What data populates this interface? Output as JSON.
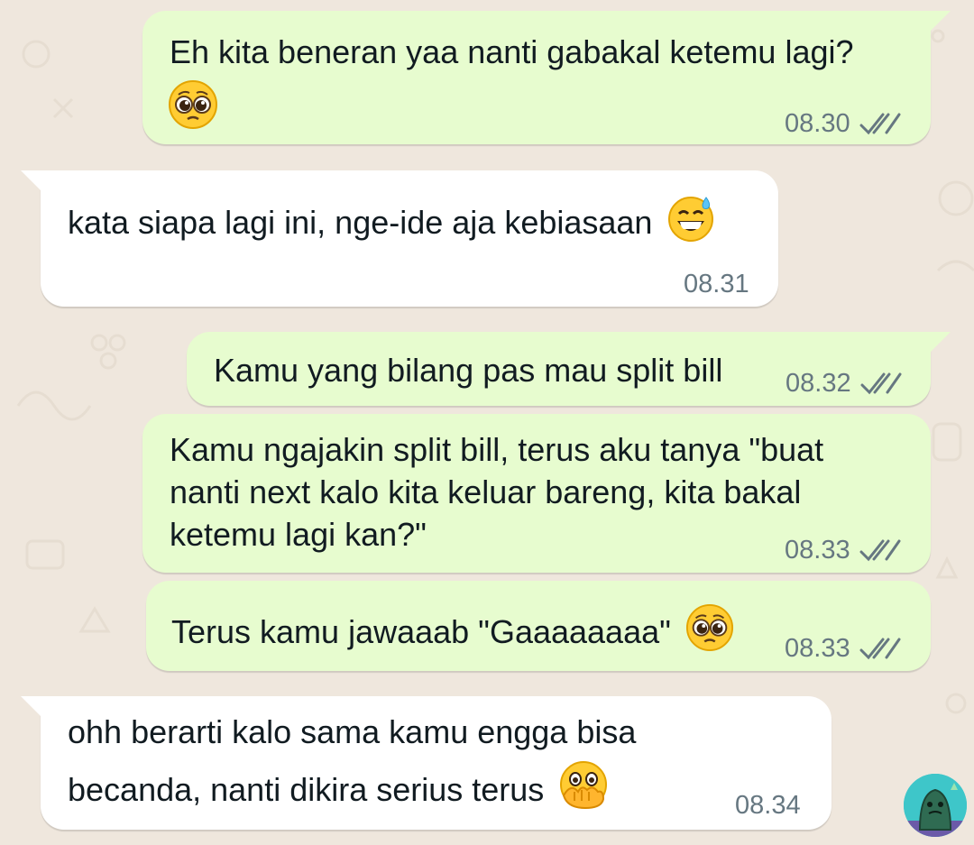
{
  "chat": {
    "messages": [
      {
        "direction": "outgoing",
        "text_lines": [
          "Eh kita beneran yaa nanti gabakal ketemu lagi?"
        ],
        "emoji": "pleading-face",
        "time": "08.30",
        "status": "read"
      },
      {
        "direction": "incoming",
        "text_lines": [
          "kata siapa lagi ini, nge-ide aja kebiasaan"
        ],
        "emoji": "grinning-face-with-sweat",
        "time": "08.31"
      },
      {
        "direction": "outgoing",
        "text_lines": [
          "Kamu yang bilang pas mau split bill"
        ],
        "time": "08.32",
        "status": "read"
      },
      {
        "direction": "outgoing",
        "text_lines": [
          "Kamu ngajakin split bill, terus aku tanya \"buat",
          "nanti next kalo kita keluar bareng, kita bakal",
          "ketemu lagi kan?\""
        ],
        "time": "08.33",
        "status": "read"
      },
      {
        "direction": "outgoing",
        "text_lines": [
          "Terus kamu jawaaab \"Gaaaaaaaa\""
        ],
        "emoji": "pleading-face",
        "time": "08.33",
        "status": "read"
      },
      {
        "direction": "incoming",
        "text_lines": [
          "ohh berarti kalo sama kamu engga bisa",
          "becanda, nanti dikira serius terus"
        ],
        "emoji": "face-with-open-eyes-and-hand-over-mouth",
        "time": "08.34"
      }
    ]
  },
  "colors": {
    "background": "#efe7dd",
    "outgoing_bubble": "#e7fccf",
    "incoming_bubble": "#ffffff",
    "text": "#111b21",
    "meta": "#667781",
    "read_tick": "#667781"
  },
  "icons": {
    "read_status": "double-check-icon",
    "avatar": "sticker-avatar-icon"
  }
}
